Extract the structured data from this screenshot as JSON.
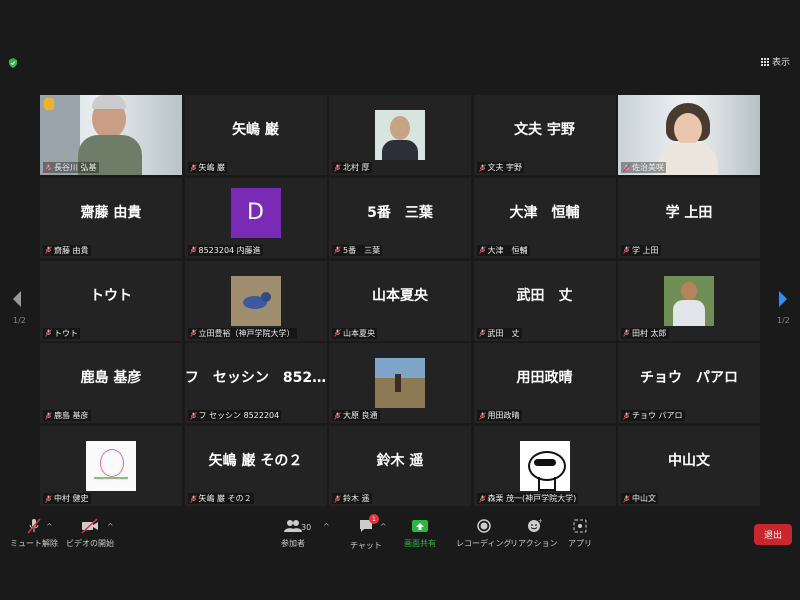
{
  "header": {
    "view_label": "表示"
  },
  "tiles": [
    {
      "big": "",
      "label": "長谷川 弘基",
      "kind": "video-hasegawa"
    },
    {
      "big": "矢嶋 巌",
      "label": "矢嶋 巌"
    },
    {
      "big": "",
      "label": "北村 厚",
      "kind": "photo-kitamura"
    },
    {
      "big": "文夫 宇野",
      "label": "文夫 宇野"
    },
    {
      "big": "",
      "label": "佐治美咲",
      "kind": "video-saji"
    },
    {
      "big": "齋藤 由貴",
      "label": "齋藤 由貴"
    },
    {
      "big": "",
      "label": "8523204 内藤進",
      "kind": "avatar-d",
      "avatar_letter": "D"
    },
    {
      "big": "5番　三葉",
      "label": "5番　三葉"
    },
    {
      "big": "大津　恒輔",
      "label": "大津　恒輔"
    },
    {
      "big": "学 上田",
      "label": "学 上田"
    },
    {
      "big": "トウト",
      "label": "トウト"
    },
    {
      "big": "",
      "label": "立田豊裕（神戸学院大学）",
      "kind": "photo-bird"
    },
    {
      "big": "山本夏央",
      "label": "山本夏央"
    },
    {
      "big": "武田　丈",
      "label": "武田　丈"
    },
    {
      "big": "",
      "label": "田村 太郎",
      "kind": "photo-tamura"
    },
    {
      "big": "鹿島 基彦",
      "label": "鹿島 基彦"
    },
    {
      "big": "フ　セッシン　852…",
      "label": "フ セッシン 8522204"
    },
    {
      "big": "",
      "label": "大原 良通",
      "kind": "photo-field"
    },
    {
      "big": "用田政晴",
      "label": "用田政晴"
    },
    {
      "big": "チョウ　パアロ",
      "label": "チョウ パアロ"
    },
    {
      "big": "",
      "label": "中村 健史",
      "kind": "photo-drawing"
    },
    {
      "big": "矢嶋 巌 その２",
      "label": "矢嶋 巌 その２"
    },
    {
      "big": "鈴木 遥",
      "label": "鈴木 遥"
    },
    {
      "big": "",
      "label": "森栗 茂一(神戸学院大学)",
      "kind": "photo-raccoon"
    },
    {
      "big": "中山文",
      "label": "中山文"
    }
  ],
  "pagination": {
    "left": "1/2",
    "right": "1/2"
  },
  "toolbar": {
    "unmute": "ミュート解除",
    "start_video": "ビデオの開始",
    "participants": "参加者",
    "participants_count": "30",
    "chat": "チャット",
    "chat_badge": "1",
    "share": "画面共有",
    "record": "レコーディング",
    "reactions": "リアクション",
    "apps": "アプリ",
    "exit": "退出"
  },
  "colors": {
    "share_green": "#2bb741",
    "exit_red": "#c9262d",
    "active_border": "#e8e86a",
    "avatar_purple": "#7a2bb5"
  }
}
